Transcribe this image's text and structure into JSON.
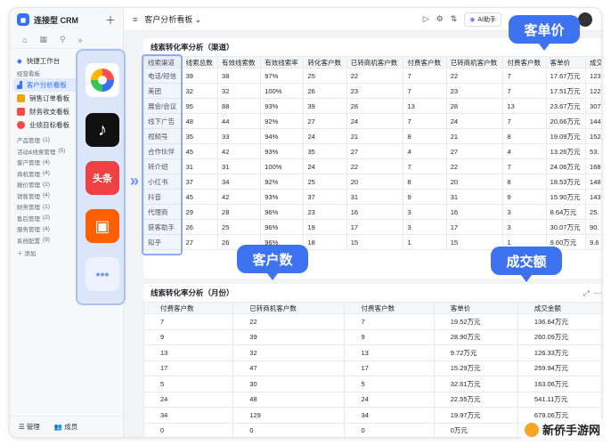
{
  "app": {
    "title": "连接型 CRM",
    "logo_icon": "chat-bubble-icon"
  },
  "sidebar": {
    "workspace": "快捷工作台",
    "section_label": "经营看板",
    "items": [
      {
        "label": "客户分析看板",
        "color": "#3370ff",
        "active": true
      },
      {
        "label": "销售订单看板",
        "color": "#e8a600",
        "active": false
      },
      {
        "label": "财务收支看板",
        "color": "#f54a45",
        "active": false
      },
      {
        "label": "业绩目标看板",
        "color": "#f54a45",
        "active": false
      }
    ],
    "groups": [
      {
        "label": "产品管理",
        "count": "(1)"
      },
      {
        "label": "活动&线索管理",
        "count": "(5)"
      },
      {
        "label": "客户管理",
        "count": "(4)"
      },
      {
        "label": "商机管理",
        "count": "(4)"
      },
      {
        "label": "报价管理",
        "count": "(2)"
      },
      {
        "label": "销售管理",
        "count": "(4)"
      },
      {
        "label": "财务管理",
        "count": "(1)"
      },
      {
        "label": "售后管理",
        "count": "(2)"
      },
      {
        "label": "服务管理",
        "count": "(4)"
      },
      {
        "label": "系统配置",
        "count": "(9)"
      }
    ],
    "add_label": "添加",
    "footer": {
      "manage": "管理",
      "members": "成员"
    }
  },
  "topbar": {
    "title": "客户分析看板",
    "ai_label": "AI助手"
  },
  "channel_table": {
    "title": "线索转化率分析（渠道）",
    "headers": [
      "线索渠道",
      "线索总数",
      "有效线索数",
      "有效线索率",
      "转化客户数",
      "已转商机客户数",
      "付费客户数",
      "已转商机客户数",
      "付费客户数",
      "客单价",
      "成交"
    ],
    "rows": [
      [
        "电话/短信",
        "39",
        "38",
        "97%",
        "25",
        "22",
        "7",
        "22",
        "7",
        "17.67万元",
        "123"
      ],
      [
        "美团",
        "32",
        "32",
        "100%",
        "26",
        "23",
        "7",
        "23",
        "7",
        "17.51万元",
        "122"
      ],
      [
        "展会/会议",
        "95",
        "88",
        "93%",
        "39",
        "28",
        "13",
        "28",
        "13",
        "23.67万元",
        "307"
      ],
      [
        "线下广告",
        "48",
        "44",
        "92%",
        "27",
        "24",
        "7",
        "24",
        "7",
        "20.66万元",
        "144"
      ],
      [
        "视频号",
        "35",
        "33",
        "94%",
        "24",
        "21",
        "8",
        "21",
        "8",
        "19.09万元",
        "152"
      ],
      [
        "合作伙伴",
        "45",
        "42",
        "93%",
        "35",
        "27",
        "4",
        "27",
        "4",
        "13.26万元",
        "53."
      ],
      [
        "转介绍",
        "31",
        "31",
        "100%",
        "24",
        "22",
        "7",
        "22",
        "7",
        "24.06万元",
        "168"
      ],
      [
        "小红书",
        "37",
        "34",
        "92%",
        "25",
        "20",
        "8",
        "20",
        "8",
        "18.53万元",
        "148"
      ],
      [
        "抖音",
        "45",
        "42",
        "93%",
        "37",
        "31",
        "9",
        "31",
        "9",
        "15.90万元",
        "143"
      ],
      [
        "代理商",
        "29",
        "28",
        "96%",
        "23",
        "16",
        "3",
        "16",
        "3",
        "8.64万元",
        "25."
      ],
      [
        "获客助手",
        "26",
        "25",
        "96%",
        "19",
        "17",
        "3",
        "17",
        "3",
        "30.07万元",
        "90."
      ],
      [
        "知乎",
        "27",
        "26",
        "96%",
        "18",
        "15",
        "1",
        "15",
        "1",
        "9.60万元",
        "9.6"
      ]
    ]
  },
  "monthly_table": {
    "title": "线索转化率分析（月份）",
    "headers": [
      "付费客户数",
      "已转商机客户数",
      "付费客户数",
      "客单价",
      "成交金额"
    ],
    "rows": [
      [
        "7",
        "22",
        "7",
        "19.52万元",
        "136.64万元"
      ],
      [
        "9",
        "39",
        "9",
        "28.90万元",
        "260.09万元"
      ],
      [
        "13",
        "32",
        "13",
        "9.72万元",
        "126.33万元"
      ],
      [
        "17",
        "47",
        "17",
        "15.29万元",
        "259.94万元"
      ],
      [
        "5",
        "30",
        "5",
        "32.61万元",
        "163.06万元"
      ],
      [
        "24",
        "48",
        "24",
        "22.55万元",
        "541.11万元"
      ],
      [
        "34",
        "129",
        "34",
        "19.97万元",
        "679.06万元"
      ],
      [
        "0",
        "0",
        "0",
        "0万元",
        "0万元"
      ]
    ]
  },
  "overlay_apps": [
    "camera-aperture-icon",
    "tiktok-icon",
    "toutiao-icon",
    "kuaishou-icon",
    "more-icon"
  ],
  "overlay_text": {
    "toutiao": "头条"
  },
  "callouts": {
    "price": "客单价",
    "customers": "客户数",
    "amount": "成交额"
  },
  "watermark": "新侨手游网"
}
